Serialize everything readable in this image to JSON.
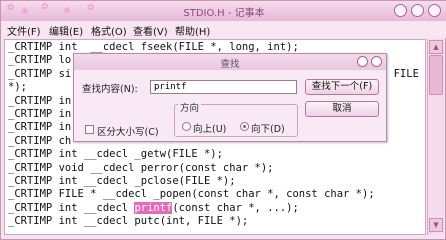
{
  "window": {
    "title": "STDIO.H - 记事本"
  },
  "menubar": {
    "items": [
      "文件(F)",
      "编辑(E)",
      "格式(O)",
      "查看(V)",
      "帮助(H)"
    ]
  },
  "editor": {
    "lines": [
      "_CRTIMP int  __cdecl fseek(FILE *, long, int);",
      "_CRTIMP lo",
      "_CRTIMP si                                                   FILE",
      "*);",
      "_CRTIMP in",
      "_CRTIMP in",
      "_CRTIMP in",
      "_CRTIMP ch",
      "_CRTIMP int __cdecl _getw(FILE *);",
      "_CRTIMP void __cdecl perror(const char *);",
      "_CRTIMP int __cdecl _pclose(FILE *);",
      "_CRTIMP FILE * __cdecl _popen(const char *, const char *);"
    ],
    "highlight_line": {
      "before": "_CRTIMP int __cdecl ",
      "match": "printf",
      "after": "(const char *, ...);"
    },
    "last_line": "_CRTIMP int __cdecl putc(int, FILE *);"
  },
  "find_dialog": {
    "title": "查找",
    "find_label": "查找内容(N):",
    "find_value": "printf",
    "find_next_button": "查找下一个(F)",
    "cancel_button": "取消",
    "direction_label": "方向",
    "up_label": "向上(U)",
    "down_label": "向下(D)",
    "selected_direction": "down",
    "match_case_label": "区分大小写(C)",
    "match_case_checked": false
  },
  "colors": {
    "accent": "#e66ab4",
    "titlebar": "#e6b9d6"
  }
}
